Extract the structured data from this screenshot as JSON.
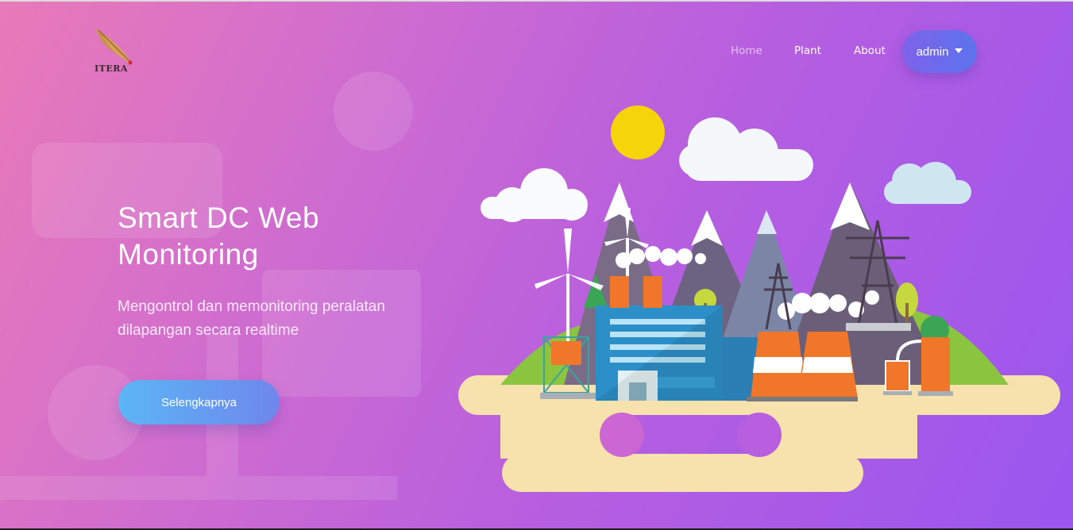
{
  "brand": {
    "logo_text": "ITERA",
    "icon": "itera-leaf-logo-icon"
  },
  "nav": {
    "home": "Home",
    "plant": "Plant",
    "about": "About",
    "user_menu": {
      "label": "admin",
      "icon": "caret-down-icon"
    }
  },
  "hero": {
    "title_line1": "Smart DC Web",
    "title_line2": "Monitoring",
    "subtitle_line1": "Mengontrol dan memonitoring peralatan",
    "subtitle_line2": "dilapangan secara realtime",
    "cta_label": "Selengkapnya"
  },
  "colors": {
    "gradient_start": "#e97ab8",
    "gradient_end": "#9a56ee",
    "cta_start": "#5bb6f5",
    "cta_end": "#6f86ec",
    "admin_start": "#7e63ea",
    "admin_end": "#5c73ec"
  },
  "illustration": {
    "icon": "power-plant-illustration"
  }
}
